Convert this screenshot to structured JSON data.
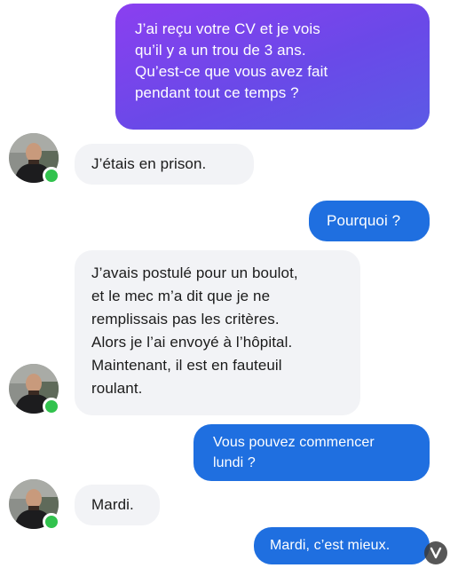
{
  "messages": {
    "m1": {
      "lines": [
        "J’ai reçu votre CV et je vois",
        "qu’il y a un trou de 3 ans.",
        "Qu’est-ce que vous avez fait",
        "pendant tout ce temps ?"
      ]
    },
    "m2": {
      "lines": [
        "J’étais en prison."
      ]
    },
    "m3": {
      "lines": [
        "Pourquoi ?"
      ]
    },
    "m4": {
      "lines": [
        "J’avais postulé pour un boulot,",
        "et le mec m’a dit que je ne",
        "remplissais pas les critères.",
        "Alors je l’ai envoyé à l’hôpital.",
        "Maintenant, il est en fauteuil",
        "roulant."
      ]
    },
    "m5": {
      "lines": [
        "Vous pouvez commencer",
        "lundi ?"
      ]
    },
    "m6": {
      "lines": [
        "Mardi."
      ]
    },
    "m7": {
      "lines": [
        "Mardi, c’est mieux."
      ]
    }
  },
  "colors": {
    "sent_bubble": "#1f6fe0",
    "first_bubble_gradient": [
      "#8b3ff0",
      "#5b5ae6"
    ],
    "received_bubble": "#f2f3f6",
    "online_status": "#31c24d"
  },
  "icons": {
    "avatar": "contact-avatar",
    "status": "online-status-dot",
    "watermark": "watermark-logo"
  }
}
